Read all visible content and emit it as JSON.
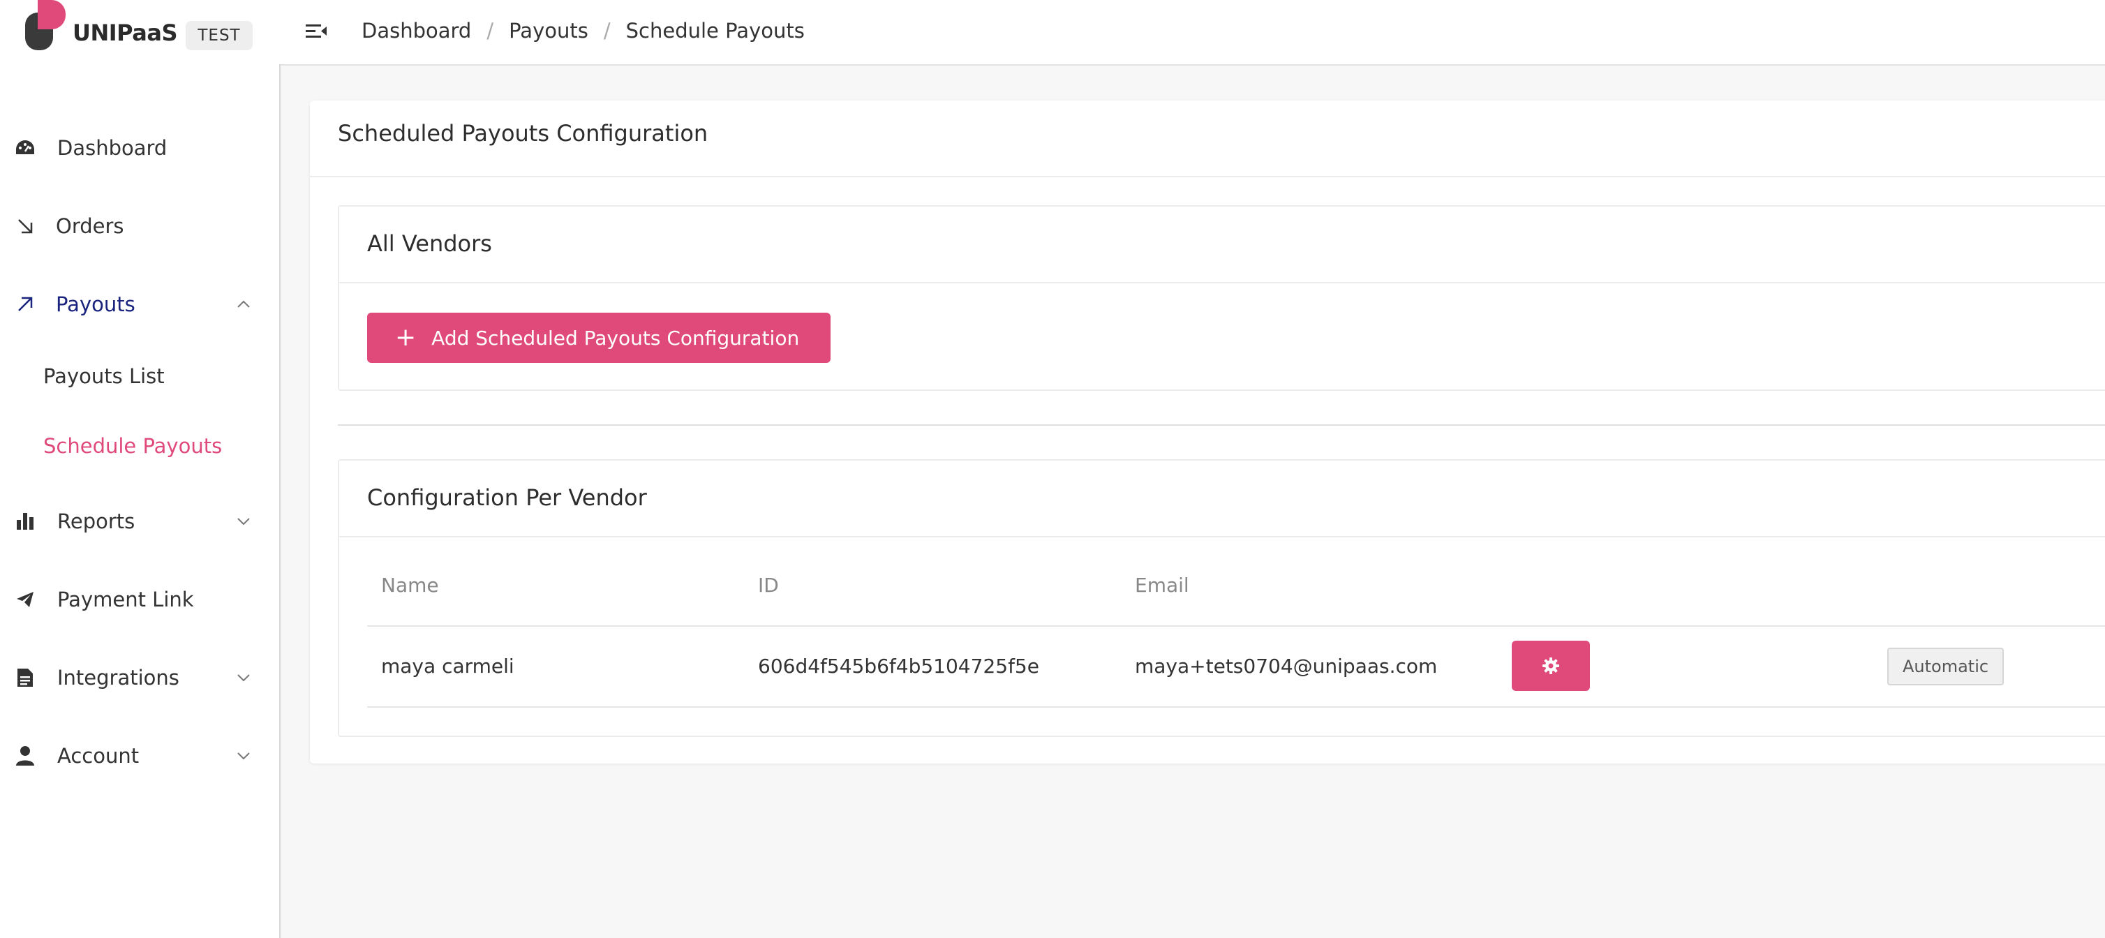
{
  "brand": {
    "name": "UNIPaaS",
    "environment": "TEST"
  },
  "breadcrumb": [
    "Dashboard",
    "Payouts",
    "Schedule Payouts"
  ],
  "sidebar": {
    "items": [
      {
        "label": "Dashboard",
        "icon": "dashboard-gauge-icon"
      },
      {
        "label": "Orders",
        "icon": "arrow-down-right-icon"
      },
      {
        "label": "Payouts",
        "icon": "arrow-up-right-icon",
        "expanded": true
      },
      {
        "label": "Reports",
        "icon": "bar-chart-icon"
      },
      {
        "label": "Payment Link",
        "icon": "paper-plane-icon"
      },
      {
        "label": "Integrations",
        "icon": "document-icon"
      },
      {
        "label": "Account",
        "icon": "user-icon"
      }
    ],
    "payouts_sub": [
      "Payouts List",
      "Schedule Payouts"
    ]
  },
  "main": {
    "title": "Scheduled Payouts Configuration",
    "all_vendors": {
      "title": "All Vendors",
      "add_button": "Add Scheduled Payouts Configuration"
    },
    "per_vendor": {
      "title": "Configuration Per Vendor",
      "columns": [
        "Name",
        "ID",
        "Email"
      ],
      "rows": [
        {
          "name": "maya carmeli",
          "id": "606d4f545b6f4b5104725f5e",
          "email": "maya+tets0704@unipaas.com",
          "mode": "Automatic"
        }
      ]
    }
  },
  "colors": {
    "accent": "#e04a7b",
    "active_nav": "#1a237e",
    "logo_dark": "#3a3a3a"
  }
}
